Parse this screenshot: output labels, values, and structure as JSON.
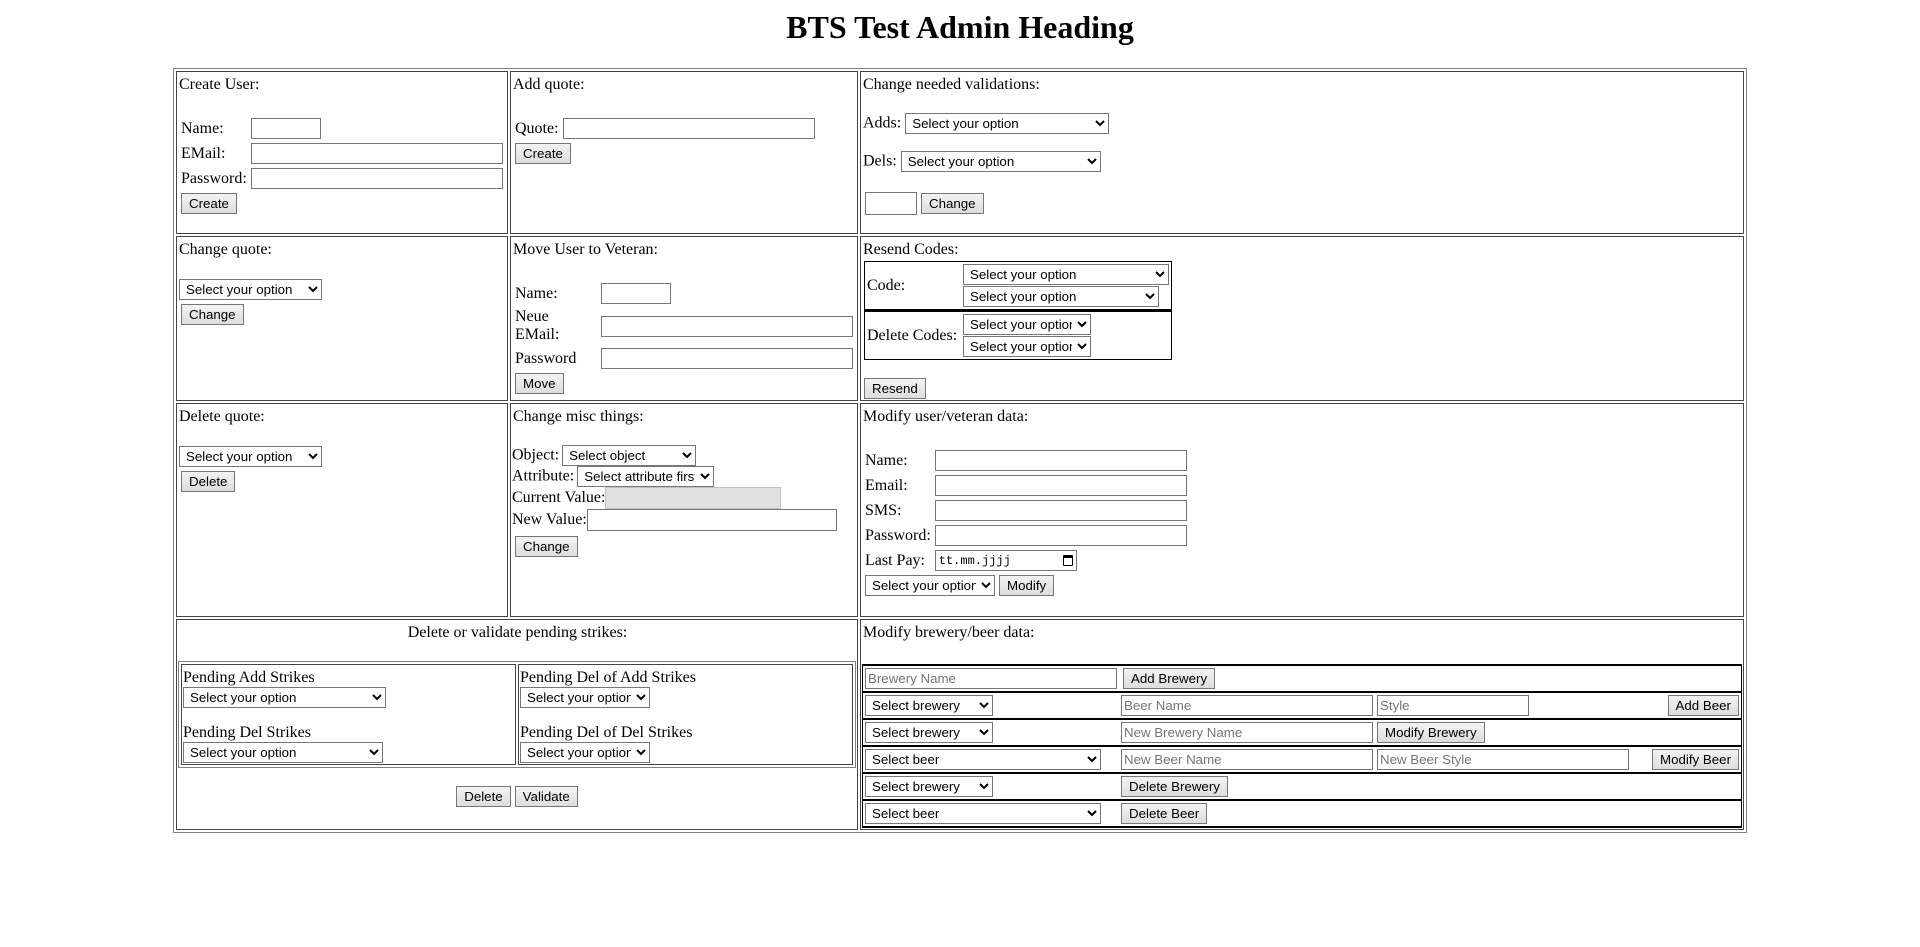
{
  "page": {
    "heading": "BTS Test Admin Heading"
  },
  "create_user": {
    "title": "Create User:",
    "name_label": "Name:",
    "email_label": "EMail:",
    "password_label": "Password:",
    "name_value": "",
    "email_value": "",
    "password_value": "",
    "button": "Create"
  },
  "add_quote": {
    "title": "Add quote:",
    "quote_label": "Quote:",
    "quote_value": "",
    "button": "Create"
  },
  "change_validations": {
    "title": "Change needed validations:",
    "adds_label": "Adds:",
    "adds_selected": "Select your option",
    "dels_label": "Dels:",
    "dels_selected": "Select your option",
    "value": "",
    "button": "Change"
  },
  "change_quote": {
    "title": "Change quote:",
    "selected": "Select your option",
    "button": "Change"
  },
  "move_veteran": {
    "title": "Move User to Veteran:",
    "name_label": "Name:",
    "email_label": "Neue EMail:",
    "password_label": "Password",
    "button": "Move"
  },
  "resend_codes": {
    "title": "Resend Codes:",
    "code_label": "Code:",
    "code_select_1": "Select your option",
    "code_select_2": "Select your option",
    "delete_label": "Delete Codes:",
    "delete_select_1": "Select your option",
    "delete_select_2": "Select your option",
    "button": "Resend"
  },
  "delete_quote": {
    "title": "Delete quote:",
    "selected": "Select your option",
    "button": "Delete"
  },
  "misc": {
    "title": "Change misc things:",
    "object_label": "Object:",
    "object_selected": "Select object",
    "attribute_label": "Attribute:",
    "attribute_selected": "Select attribute first",
    "current_label": "Current Value:",
    "current_value": "",
    "new_label": "New Value:",
    "new_value": "",
    "button": "Change"
  },
  "modify_user": {
    "title": "Modify user/veteran data:",
    "name_label": "Name:",
    "email_label": "Email:",
    "sms_label": "SMS:",
    "password_label": "Password:",
    "lastpay_label": "Last Pay:",
    "lastpay_placeholder": "tt.mm.jjjj",
    "selected": "Select your option",
    "button": "Modify"
  },
  "strikes": {
    "title": "Delete or validate pending strikes:",
    "pending_add_label": "Pending Add Strikes",
    "pending_add_selected": "Select your option",
    "pending_del_label": "Pending Del Strikes",
    "pending_del_selected": "Select your option",
    "pending_del_add_label": "Pending Del of Add Strikes",
    "pending_del_add_selected": "Select your option",
    "pending_del_del_label": "Pending Del of Del Strikes",
    "pending_del_del_selected": "Select your option",
    "delete_button": "Delete",
    "validate_button": "Validate"
  },
  "brewery": {
    "title": "Modify brewery/beer data:",
    "brewery_name_placeholder": "Brewery Name",
    "add_brewery_button": "Add Brewery",
    "select_brewery": "Select brewery",
    "beer_name_placeholder": "Beer Name",
    "style_placeholder": "Style",
    "add_beer_button": "Add Beer",
    "new_brewery_name_placeholder": "New Brewery Name",
    "modify_brewery_button": "Modify Brewery",
    "select_beer": "Select beer",
    "new_beer_name_placeholder": "New Beer Name",
    "new_beer_style_placeholder": "New Beer Style",
    "modify_beer_button": "Modify Beer",
    "delete_brewery_button": "Delete Brewery",
    "delete_beer_button": "Delete Beer"
  }
}
